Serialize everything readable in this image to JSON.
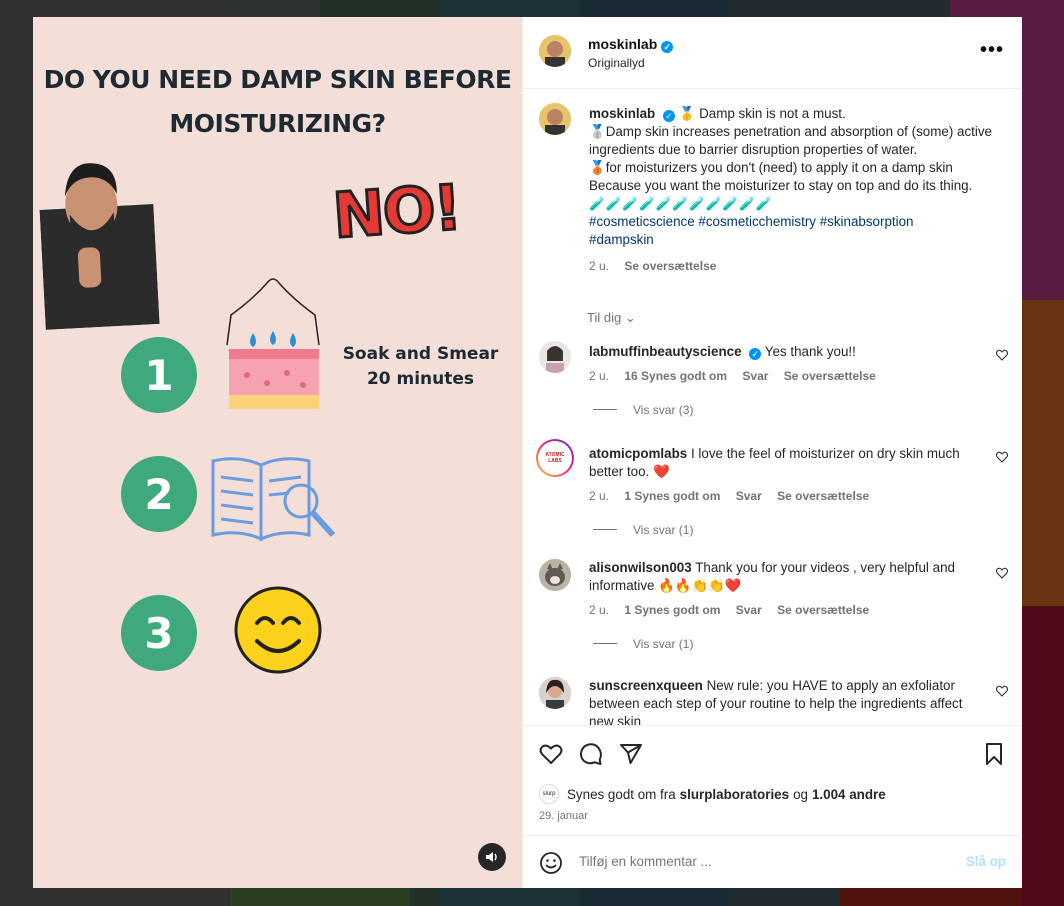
{
  "media": {
    "title_line1": "DO YOU NEED DAMP SKIN BEFORE",
    "title_line2": "MOISTURIZING?",
    "no_text": "NO!",
    "steps": [
      "1",
      "2",
      "3"
    ],
    "soak_line1": "Soak and Smear",
    "soak_line2": "20 minutes"
  },
  "post": {
    "username": "moskinlab",
    "audio": "Originallyd",
    "caption": {
      "line1": " Damp skin is not a must.",
      "line2": "Damp skin increases penetration and absorption of (some) active ingredients due to barrier disruption properties of water.",
      "line3": "for moisturizers you don't (need) to apply it on a damp skin",
      "line4": "Because you want the moisturizer to stay on top and do its thing.",
      "tubes": "🧪🧪🧪🧪🧪🧪🧪🧪🧪🧪🧪",
      "hashtags_line1": "#cosmeticscience #cosmeticchemistry #skinabsorption",
      "hashtags_line2": "#dampskin",
      "time": "2 u.",
      "translate": "Se oversættelse"
    },
    "for_you": "Til dig"
  },
  "comments": [
    {
      "username": "labmuffinbeautyscience",
      "text": "Yes thank you!!",
      "time": "2 u.",
      "likes": "16 Synes godt om",
      "reply": "Svar",
      "translate": "Se oversættelse",
      "view_replies": "Vis svar (3)"
    },
    {
      "username": "atomicpomlabs",
      "text": "I love the feel of moisturizer on dry skin much better too. ❤️",
      "time": "2 u.",
      "likes": "1 Synes godt om",
      "reply": "Svar",
      "translate": "Se oversættelse",
      "view_replies": "Vis svar (1)",
      "avatar_text": "ATOMIC LABS"
    },
    {
      "username": "alisonwilson003",
      "text": "Thank you for your videos , very helpful and informative 🔥🔥👏👏❤️",
      "time": "2 u.",
      "likes": "1 Synes godt om",
      "reply": "Svar",
      "translate": "Se oversættelse",
      "view_replies": "Vis svar (1)"
    },
    {
      "username": "sunscreenxqueen",
      "text": "New rule: you HAVE to apply an exfoliator between each step of your routine to help the ingredients affect new skin"
    }
  ],
  "likes": {
    "prefix": "Synes godt om fra",
    "user": "slurplaboratories",
    "and": "og",
    "others": "1.004 andre",
    "mini_avatar": "slurp"
  },
  "date": "29. januar",
  "add_comment": {
    "placeholder": "Tilføj en kommentar ...",
    "post_label": "Slå op"
  },
  "colors": {
    "media_bg": "#f3dfd8",
    "step_green": "#3fa97d",
    "link_blue": "#00376b",
    "verified_blue": "#0095f6"
  }
}
